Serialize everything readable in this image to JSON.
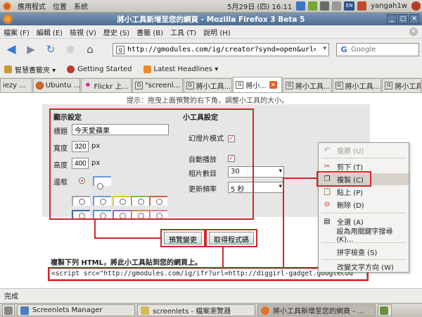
{
  "top_panel": {
    "menus": [
      "應用程式",
      "位置",
      "系統"
    ],
    "date_time": "5月29日 (四) 16:11",
    "user": "yangah1w",
    "keyboard_layout": "EN"
  },
  "window": {
    "title": "將小工具新增至您的網頁 - Mozilla Firefox 3 Beta 5"
  },
  "menu_bar": {
    "items": [
      "檔案 (F)",
      "編輯 (E)",
      "檢視 (V)",
      "歷史 (S)",
      "書籤 (B)",
      "工具 (T)",
      "說明 (H)"
    ]
  },
  "nav": {
    "url": "http://gmodules.com/ig/creator?synd=open&url=htt",
    "search_placeholder": "Google"
  },
  "bookmarks": {
    "items": [
      "智慧書籤夾 ▾",
      "Getting Started",
      "Latest Headlines ▾"
    ]
  },
  "tabs": [
    {
      "label": "iezy ..."
    },
    {
      "label": "Ubuntu ..."
    },
    {
      "label": "Flickr 上..."
    },
    {
      "label": "\"screenl..."
    },
    {
      "label": "將小工具..."
    },
    {
      "label": "將小..."
    },
    {
      "label": "將小工具..."
    },
    {
      "label": "將小工具..."
    },
    {
      "label": "將小工具..."
    }
  ],
  "page": {
    "hint": "提示：拖曳上面預覽的右下角，調整小工具的大小。",
    "display_settings": {
      "heading": "顯示設定",
      "title_label": "標題",
      "title_value": "今天愛蘋果",
      "width_label": "寬度",
      "width_value": "320",
      "height_label": "高度",
      "height_value": "400",
      "unit": "px",
      "border_label": "邊框"
    },
    "gadget_settings": {
      "heading": "小工具設定",
      "slideshow_label": "幻燈片模式",
      "autoplay_label": "自動播放",
      "photo_count_label": "相片數目",
      "photo_count_value": "30",
      "refresh_label": "更新頻率",
      "refresh_value": "5 秒"
    },
    "preview_button": "預覽變更",
    "get_code_button": "取得程式碼",
    "copy_label": "複製下列 HTML，將此小工具貼到您的網頁上。",
    "code": "<script src=\"http://gmodules.com/ig/ifr?url=http://diggirl-gadget.googlecod"
  },
  "context_menu": {
    "items": [
      {
        "label": "復原 (U)",
        "state": "disabled"
      },
      {
        "label": "剪下 (T)",
        "state": "normal"
      },
      {
        "label": "複製 (C)",
        "state": "highlight"
      },
      {
        "label": "貼上 (P)",
        "state": "normal"
      },
      {
        "label": "刪除 (D)",
        "state": "normal"
      },
      {
        "label": "全選 (A)",
        "state": "normal"
      },
      {
        "label": "設為用關鍵字搜尋 (K)...",
        "state": "normal"
      },
      {
        "label": "拼字檢查 (S)",
        "state": "normal"
      },
      {
        "label": "改變文字方向 (W)",
        "state": "normal"
      }
    ]
  },
  "status_bar": {
    "text": "完成"
  },
  "taskbar": {
    "items": [
      "Screenlets Manager",
      "screenlets - 檔案瀏覽器",
      "將小工具新增至您的網頁 - ..."
    ]
  },
  "colors": {
    "annotation_red": "#d1262a",
    "panel_gray": "#e6e6e6",
    "title_bar_blue": "#4b6d92"
  }
}
